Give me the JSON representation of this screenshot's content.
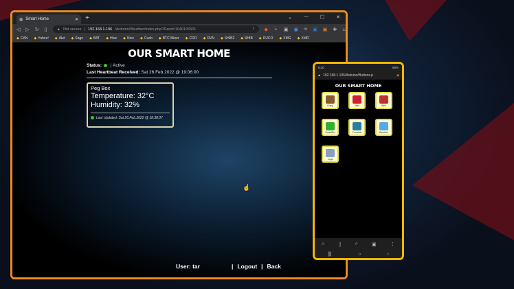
{
  "browser": {
    "tab_title": "Smart Home",
    "url_warning": "Not secure",
    "url_host": "192.168.1.106",
    "url_path": "/Arduino/Weather/index.php?Rand=1040126501",
    "bookmarks": [
      "CAN",
      "Yahoo!",
      "iNet",
      "Sage",
      "BAT",
      "Hive",
      "Nice",
      "Cudo",
      "BTC Miner",
      "CRO",
      "RVN",
      "SHIB2",
      "SHIB",
      "DUCO",
      "XMG",
      "XMR"
    ]
  },
  "page": {
    "title": "OUR SMART HOME",
    "status_label": "Status:",
    "status_value": "Active",
    "heartbeat_label": "Last Heartbeat Received:",
    "heartbeat_value": "Sat 26.Feb.2022 @ 19:06:00",
    "card": {
      "name": "Peg Box",
      "temperature": "Temperature: 32°C",
      "humidity": "Humidity: 32%",
      "updated": "Last Updated: Sat 26.Feb.2022 @ 18:38:07"
    },
    "footer": {
      "user": "User: tar",
      "logout": "Logout",
      "back": "Back"
    }
  },
  "phone": {
    "time": "6:30",
    "battery": "68%",
    "url": "192.168.1.106/Arduino/Buttons.p",
    "title": "OUR SMART HOME",
    "buttons": [
      {
        "label": "Diary",
        "color": "#8a5a2a"
      },
      {
        "label": "Mail",
        "color": "#d02030"
      },
      {
        "label": "Bills",
        "color": "#c03030"
      },
      {
        "label": "SmartBin",
        "color": "#30b030"
      },
      {
        "label": "Fountain",
        "color": "#2a7fa0"
      },
      {
        "label": "Weather",
        "color": "#58a8e8"
      },
      {
        "label": "Logs",
        "color": "#8aa0c0"
      }
    ]
  },
  "colors": {
    "browser_border": "#f08a1c",
    "phone_border": "#f5b800",
    "status_ok": "#2ecc2e"
  }
}
